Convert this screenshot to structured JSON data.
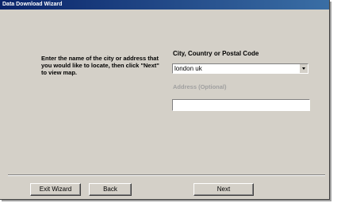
{
  "window": {
    "title": "Data Download Wizard"
  },
  "instructions": {
    "text": "Enter the name of the city or address that you would like to locate, then click \"Next\" to view map."
  },
  "city_field": {
    "label": "City, Country or Postal Code",
    "value": "london uk"
  },
  "address_field": {
    "label": "Address (Optional)",
    "value": ""
  },
  "buttons": {
    "exit_label": "Exit Wizard",
    "back_label": "Back",
    "next_label": "Next"
  },
  "colors": {
    "titlebar_start": "#0a246a",
    "titlebar_end": "#3a6ea5",
    "dialog_face": "#d4d0c8",
    "disabled_text": "#a0a0a0"
  },
  "icons": {
    "combo_dropdown": "chevron-down-icon"
  }
}
